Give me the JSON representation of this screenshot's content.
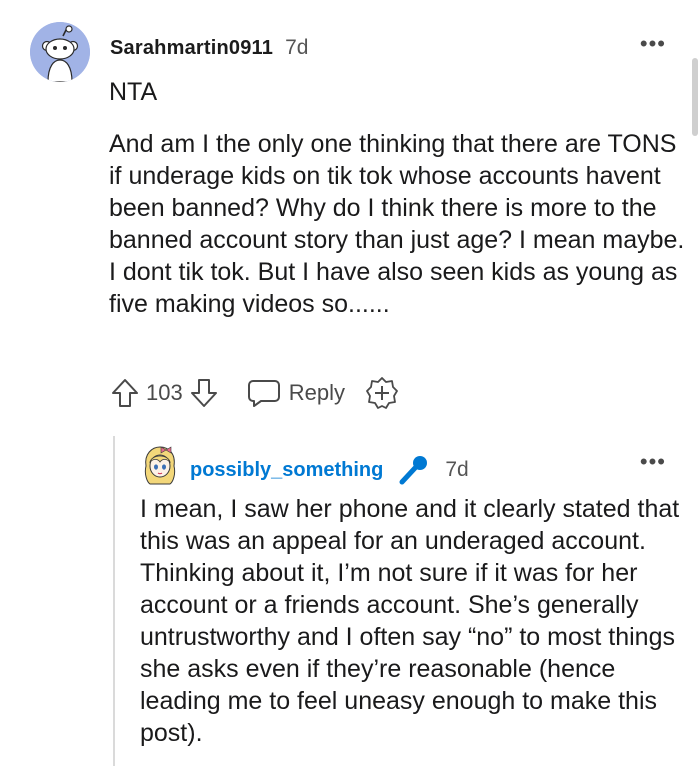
{
  "comment": {
    "username": "Sarahmartin0911",
    "age": "7d",
    "more_icon": "more-dots-icon",
    "avatar_color": "#a1b3e6",
    "body": [
      "NTA",
      "And am I the only one thinking that there are TONS if underage kids on tik tok whose accounts havent been banned? Why do I think there is more to the banned account story than just age? I mean maybe. I dont tik tok. But I have also seen kids as young as five making videos so......"
    ],
    "actions": {
      "upvote_icon": "upvote-arrow-icon",
      "score": "103",
      "downvote_icon": "downvote-arrow-icon",
      "reply_icon": "chat-bubble-icon",
      "reply_label": "Reply",
      "award_icon": "award-plus-icon"
    }
  },
  "reply": {
    "username": "possibly_something",
    "username_color": "#0079d3",
    "badge_icon": "microphone-icon",
    "badge_color": "#0079d3",
    "age": "7d",
    "more_icon": "more-dots-icon",
    "body": "I mean, I saw her phone and it clearly stated that this was an appeal for an underaged account. Thinking about it, I’m not sure if it was for her account or a friends account. She’s generally untrustworthy and I often say “no” to most things she asks even if they’re reasonable (hence leading me to feel uneasy enough to make this post)."
  }
}
